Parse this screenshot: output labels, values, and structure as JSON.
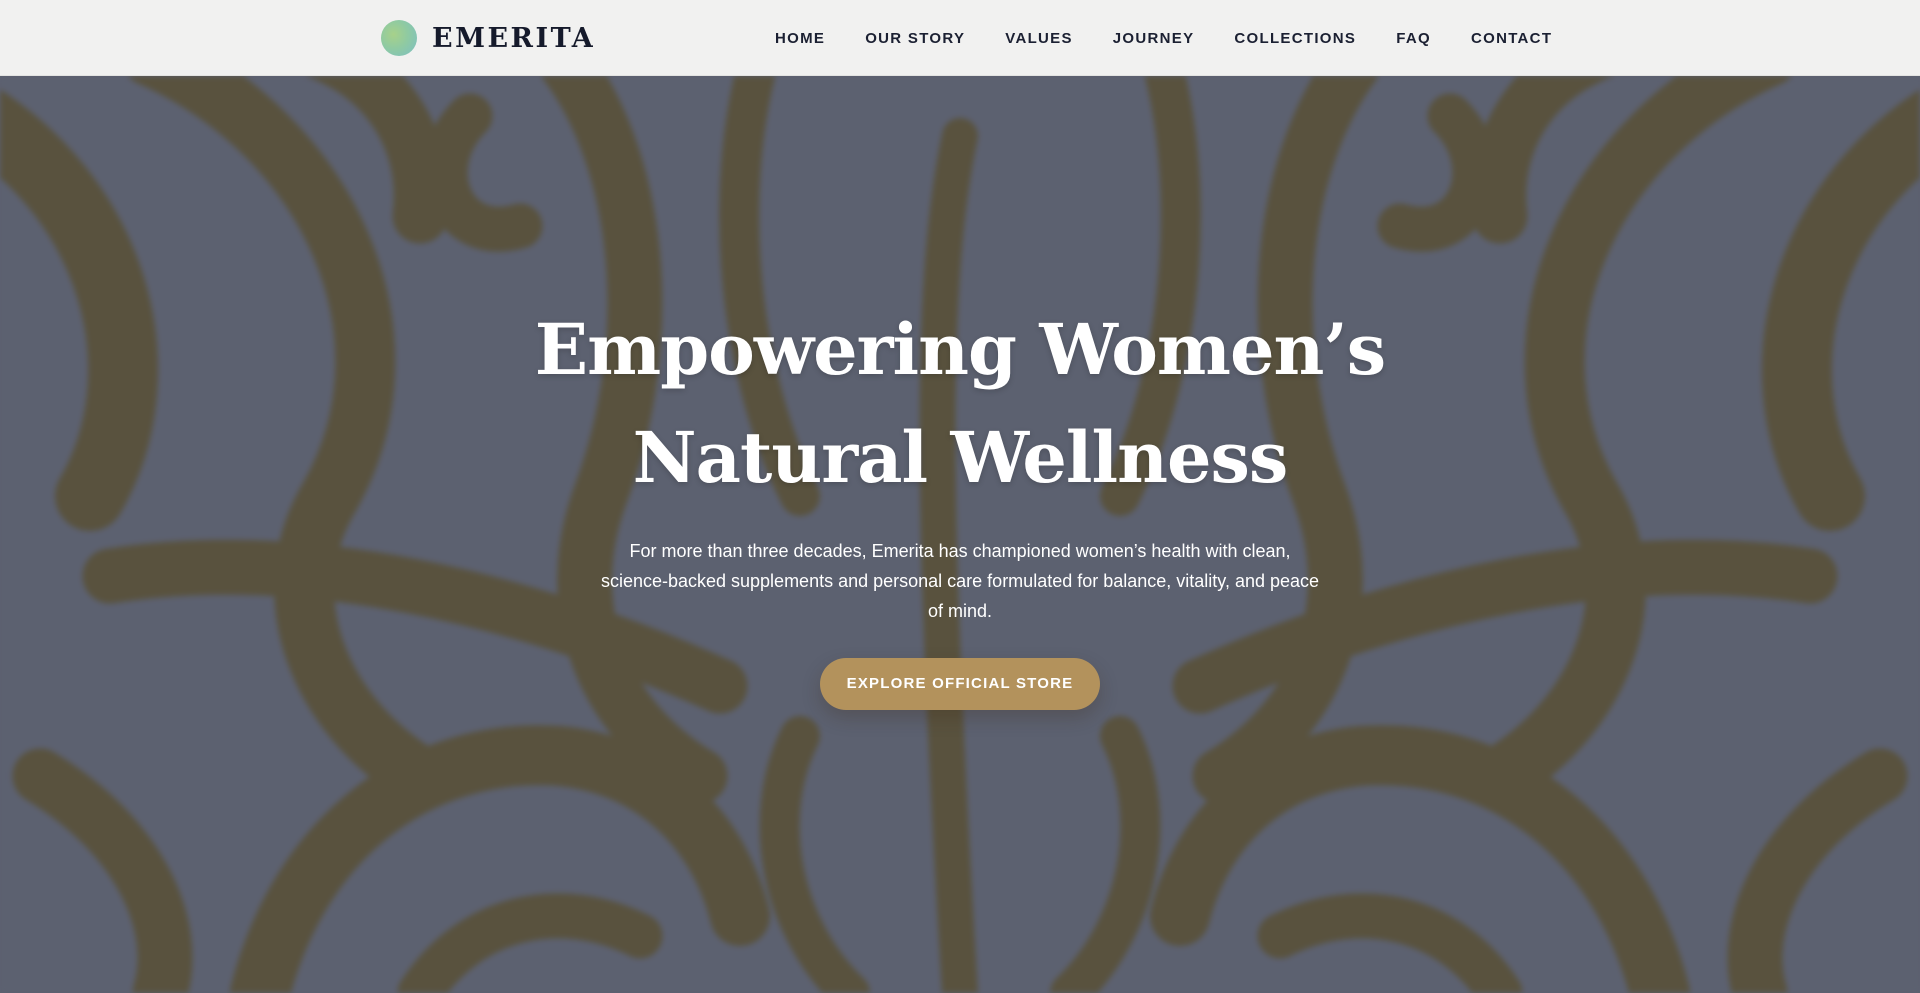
{
  "colors": {
    "header_bg": "#f1f1f0",
    "brand_text": "#151a2b",
    "hero_bg": "#5d6271",
    "ornament": "#5a5034",
    "cta_bg": "#b3925c",
    "hero_text": "#ffffff"
  },
  "header": {
    "brand": {
      "logo_icon": "gradient-circle-logo",
      "name": "EMERITA"
    },
    "nav": [
      {
        "label": "HOME"
      },
      {
        "label": "OUR STORY"
      },
      {
        "label": "VALUES"
      },
      {
        "label": "JOURNEY"
      },
      {
        "label": "COLLECTIONS"
      },
      {
        "label": "FAQ"
      },
      {
        "label": "CONTACT"
      }
    ]
  },
  "hero": {
    "background_image": "ornamental-damask-pattern",
    "title": "Empowering Women’s Natural Wellness",
    "subtitle": "For more than three decades, Emerita has championed women’s health with clean, science-backed supplements and personal care formulated for balance, vitality, and peace of mind.",
    "cta_label": "EXPLORE OFFICIAL STORE"
  }
}
